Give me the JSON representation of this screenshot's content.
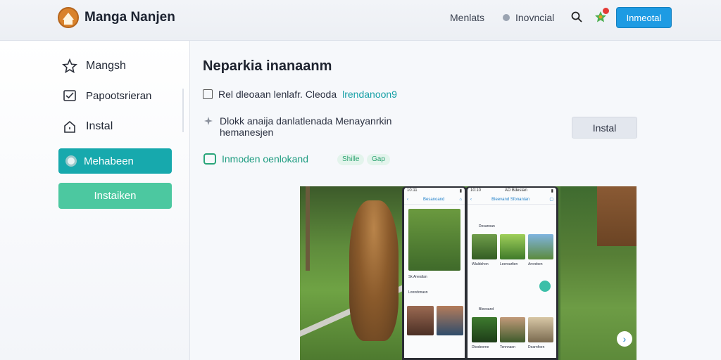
{
  "header": {
    "brand": "Manga Nanjen",
    "nav_menu": "Menlats",
    "nav_second": "Inovncial",
    "cta": "Inmeotal"
  },
  "sidebar": {
    "items": [
      {
        "label": "Mangsh",
        "icon": "star-outline-icon"
      },
      {
        "label": "Papootsrieran",
        "icon": "mail-check-icon"
      },
      {
        "label": "Instal",
        "icon": "home-icon"
      }
    ],
    "active_item": "Mehabeen",
    "cta": "Instaiken"
  },
  "main": {
    "title": "Neparkia inanaanm",
    "row1_text": "Rel dleoaan lenlafr. Cleoda",
    "row1_link": "lrendanoon9",
    "row2_text": "Dlokk anaija danlatlenada Menayanrkin hemanesjen",
    "install_label": "Instal",
    "row3_text": "Inmoden oenlokand",
    "chips": [
      "Shille",
      "Gap"
    ]
  },
  "preview": {
    "phone1": {
      "status_left": "10:11",
      "bar_title": "Besanoand",
      "caption1": "Sk Anealtan",
      "caption2": "Lonndonasn"
    },
    "phone2": {
      "status_left": "10:10",
      "status_mid": "AD Bdestan",
      "bar_title": "Bleevand Sfonantan",
      "section1": "Desanoan",
      "section2": "Bleeoand",
      "captions": [
        "Wlaldehon",
        "Leeroarlten",
        "Aroreben",
        "Dkodeorne",
        "Tennnaon",
        "Dearnfoen"
      ]
    },
    "colors": {
      "accent": "#17a9ad",
      "cta_green": "#4cc8a0",
      "primary_blue": "#1e9be3"
    }
  }
}
